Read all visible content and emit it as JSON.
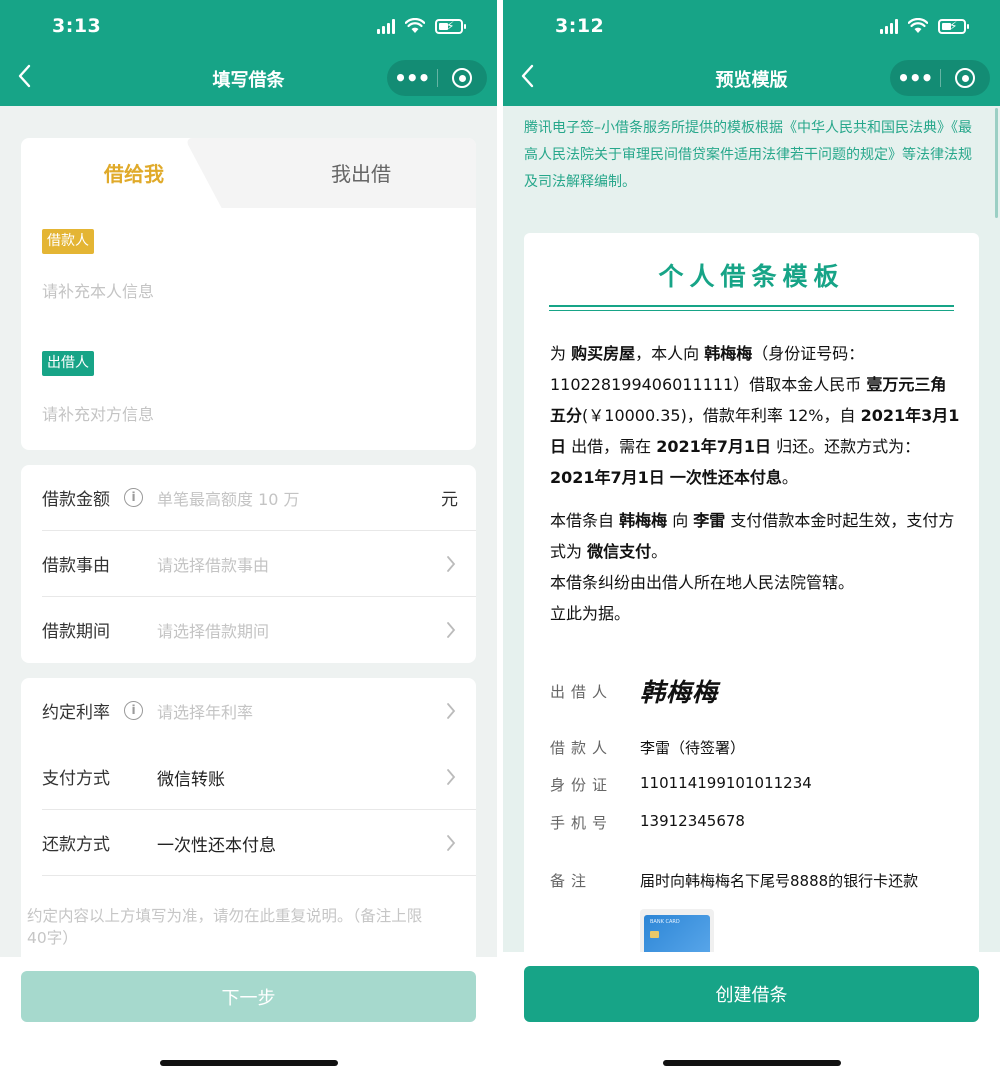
{
  "left": {
    "status": {
      "time": "3:13"
    },
    "nav": {
      "title": "填写借条",
      "more_glyph": "•••"
    },
    "tabs": {
      "active": "借给我",
      "inactive": "我出借"
    },
    "borrower": {
      "badge": "借款人",
      "placeholder": "请补充本人信息"
    },
    "lender": {
      "badge": "出借人",
      "placeholder": "请补充对方信息"
    },
    "amount": {
      "label": "借款金额",
      "placeholder": "单笔最高额度 10 万",
      "unit": "元",
      "info_glyph": "i"
    },
    "reason": {
      "label": "借款事由",
      "placeholder": "请选择借款事由"
    },
    "period": {
      "label": "借款期间",
      "placeholder": "请选择借款期间"
    },
    "rate": {
      "label": "约定利率",
      "placeholder": "请选择年利率",
      "info_glyph": "i"
    },
    "payment": {
      "label": "支付方式",
      "value": "微信转账"
    },
    "repayment": {
      "label": "还款方式",
      "value": "一次性还本付息"
    },
    "remark_placeholder": "约定内容以上方填写为准，请勿在此重复说明。（备注上限 40字）",
    "next_button": "下一步"
  },
  "right": {
    "status": {
      "time": "3:12"
    },
    "nav": {
      "title": "预览模版",
      "more_glyph": "•••"
    },
    "notice": "腾讯电子签–小借条服务所提供的模板根据《中华人民共和国民法典》《最高人民法院关于审理民间借贷案件适用法律若干问题的规定》等法律法规及司法解释编制。",
    "doc": {
      "title": "个人借条模板",
      "p1": {
        "t1": "为 ",
        "purpose": "购买房屋",
        "t2": "，本人向 ",
        "lender": "韩梅梅",
        "t3": "（身份证号码：110228199406011111）借取本金人民币 ",
        "amount_cn": "壹万元三角五分",
        "t4": "(￥10000.35)，借款年利率 12%，自 ",
        "start": "2021年3月1日",
        "t5": " 出借，需在 ",
        "end": "2021年7月1日",
        "t6": " 归还。还款方式为： ",
        "repay_date": "2021年7月1日",
        "repay_method": "一次性还本付息",
        "t7": "。"
      },
      "p2": {
        "t1": "本借条自 ",
        "lender": "韩梅梅",
        "t2": " 向 ",
        "borrower": "李雷",
        "t3": " 支付借款本金时起生效，支付方式为 ",
        "pay": "微信支付",
        "t4": "。"
      },
      "p3": "本借条纠纷由出借人所在地人民法院管辖。",
      "p4": "立此为据。",
      "fields": {
        "lender_label": "出借人",
        "lender_sign": "韩梅梅",
        "borrower_label": "借款人",
        "borrower_value": "李雷（待签署）",
        "id_label": "身份证",
        "id_value": "110114199101011234",
        "phone_label": "手机号",
        "phone_value": "13912345678",
        "note_label": "备注",
        "note_value": "届时向韩梅梅名下尾号8888的银行卡还款"
      },
      "bank_card_text": "BANK CARD"
    },
    "create_button": "创建借条"
  },
  "colors": {
    "brand": "#17a487",
    "accent_yellow": "#e0aa2a",
    "disabled": "#a6d9cd"
  }
}
